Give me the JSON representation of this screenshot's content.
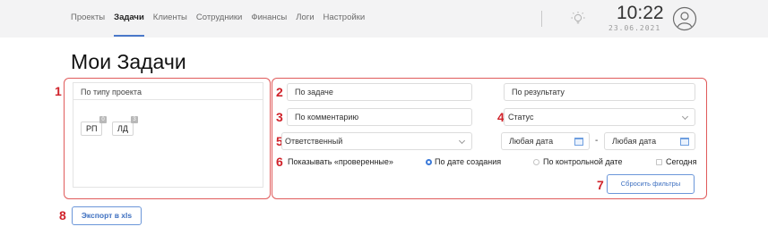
{
  "nav": {
    "items": [
      {
        "label": "Проекты",
        "active": false
      },
      {
        "label": "Задачи",
        "active": true
      },
      {
        "label": "Клиенты",
        "active": false
      },
      {
        "label": "Сотрудники",
        "active": false
      },
      {
        "label": "Финансы",
        "active": false
      },
      {
        "label": "Логи",
        "active": false
      },
      {
        "label": "Настройки",
        "active": false
      }
    ],
    "theme_icon": "lightbulb-icon",
    "time": "10:22",
    "date": "23.06.2021",
    "avatar_icon": "user-avatar-icon",
    "accent_color": "#4a78c9"
  },
  "page": {
    "title": "Мои Задачи"
  },
  "annotations": [
    "1",
    "2",
    "3",
    "4",
    "5",
    "6",
    "7",
    "8"
  ],
  "annotation_color": "#d0222a",
  "project_filter": {
    "header": "По типу проекта",
    "tags": [
      {
        "label": "РП",
        "count": "0"
      },
      {
        "label": "ЛД",
        "count": "3"
      }
    ]
  },
  "filters": {
    "task_placeholder": "По задаче",
    "result_placeholder": "По результату",
    "comment_placeholder": "По комментарию",
    "status_label": "Статус",
    "responsible_label": "Ответственный",
    "date_from": "Любая дата",
    "date_separator": "-",
    "date_to": "Любая дата",
    "show_checked": "Показывать «проверенные»",
    "radio_created": "По дате создания",
    "radio_control": "По контрольной дате",
    "today": "Сегодня",
    "reset_button": "Сбросить фильтры"
  },
  "export_button": "Экспорт в xls"
}
